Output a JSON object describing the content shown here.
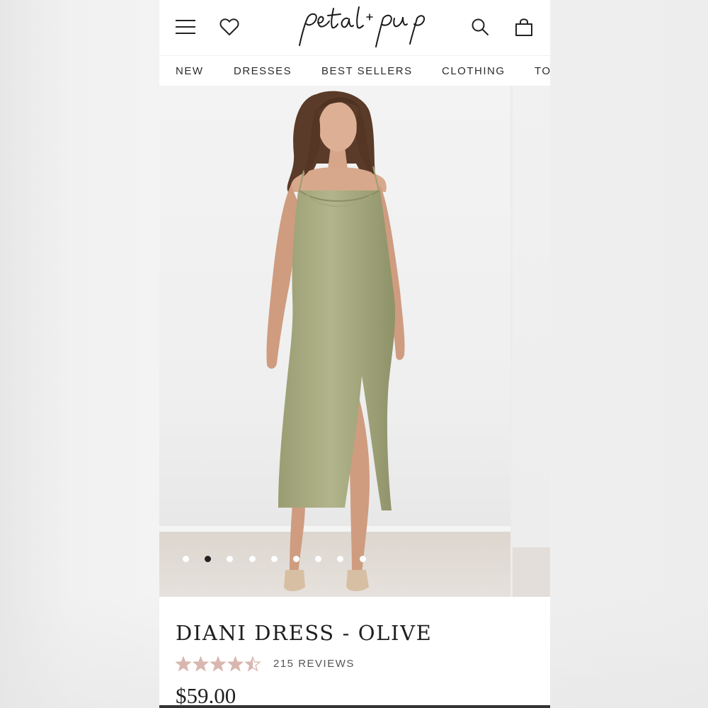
{
  "brand": {
    "logo_text": "petal + pup"
  },
  "header": {
    "icons": [
      "hamburger-menu-icon",
      "heart-icon",
      "search-icon",
      "shopping-bag-icon"
    ]
  },
  "nav": {
    "items": [
      "NEW",
      "DRESSES",
      "BEST SELLERS",
      "CLOTHING",
      "TO"
    ]
  },
  "gallery": {
    "dot_count": 9,
    "active_dot_index": 1,
    "dress_color": "#a9ad82"
  },
  "product": {
    "title": "DIANI DRESS - OLIVE",
    "rating": 4.5,
    "max_rating": 5,
    "star_color": "#d9b7b0",
    "reviews_label": "215 REVIEWS",
    "price": "$59.00"
  }
}
